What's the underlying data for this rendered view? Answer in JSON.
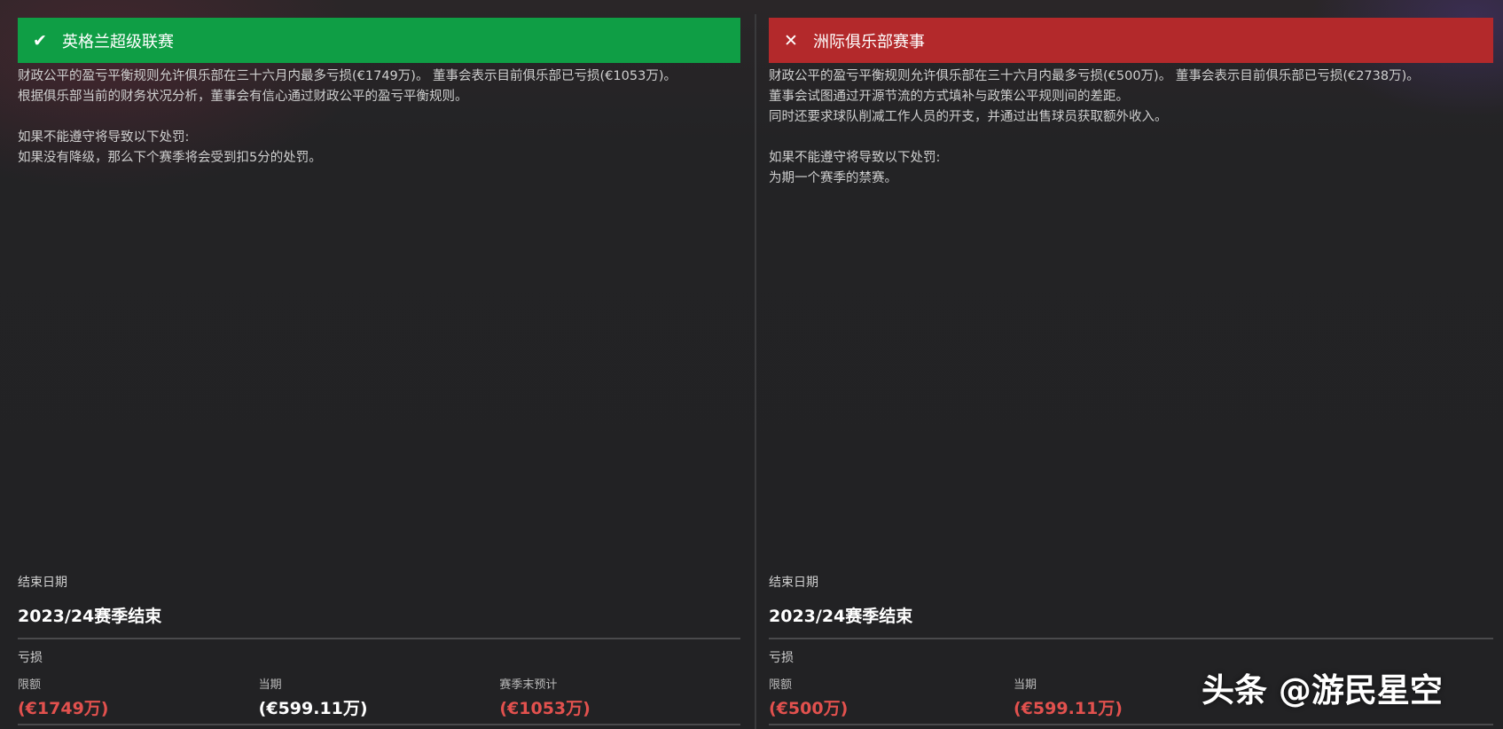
{
  "left": {
    "title": "英格兰超级联赛",
    "status_icon": "check-icon",
    "status_color": "#0f9e45",
    "description": [
      "财政公平的盈亏平衡规则允许俱乐部在三十六月内最多亏损(€1749万)。 董事会表示目前俱乐部已亏损(€1053万)。",
      "根据俱乐部当前的财务状况分析，董事会有信心通过财政公平的盈亏平衡规则。",
      "",
      "如果不能遵守将导致以下处罚:",
      "如果没有降级，那么下个赛季将会受到扣5分的处罚。"
    ],
    "end_date_label": "结束日期",
    "end_date_value": "2023/24赛季结束",
    "loss_label": "亏损",
    "stats": [
      {
        "label": "限额",
        "value": "(€1749万)",
        "color": "red"
      },
      {
        "label": "当期",
        "value": "(€599.11万)",
        "color": "white"
      },
      {
        "label": "赛季末预计",
        "value": "(€1053万)",
        "color": "red"
      }
    ]
  },
  "right": {
    "title": "洲际俱乐部赛事",
    "status_icon": "close-icon",
    "status_color": "#b3292b",
    "description": [
      "财政公平的盈亏平衡规则允许俱乐部在三十六月内最多亏损(€500万)。 董事会表示目前俱乐部已亏损(€2738万)。",
      "董事会试图通过开源节流的方式填补与政策公平规则间的差距。",
      "同时还要求球队削减工作人员的开支，并通过出售球员获取额外收入。",
      "",
      "如果不能遵守将导致以下处罚:",
      "为期一个赛季的禁赛。"
    ],
    "end_date_label": "结束日期",
    "end_date_value": "2023/24赛季结束",
    "loss_label": "亏损",
    "stats": [
      {
        "label": "限额",
        "value": "(€500万)",
        "color": "red"
      },
      {
        "label": "当期",
        "value": "(€599.11万)",
        "color": "red"
      }
    ]
  },
  "watermark": "头条 @游民星空"
}
